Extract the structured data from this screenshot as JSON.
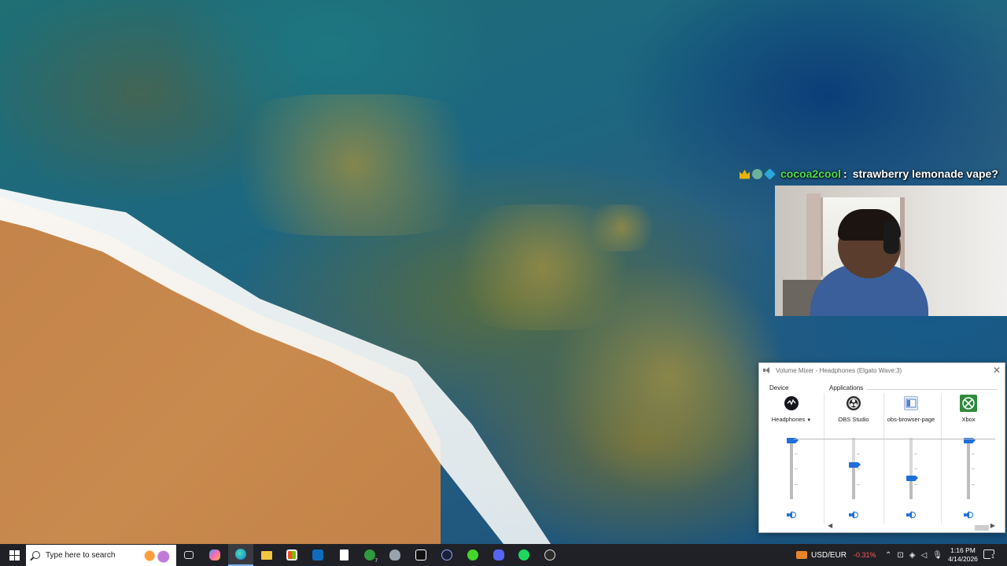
{
  "chat": {
    "username": "cocoa2cool",
    "separator": ":",
    "message": "strawberry lemonade vape?",
    "username_color": "#4ddc4d",
    "badges": [
      "crown-badge",
      "frog-badge",
      "gem-badge"
    ]
  },
  "mixer": {
    "title": "Volume Mixer - Headphones (Elgato Wave:3)",
    "close_label": "✕",
    "device_label": "Device",
    "applications_label": "Applications",
    "channels": [
      {
        "name": "Headphones",
        "icon": "headphones-device-icon",
        "volume": 1.0,
        "has_dropdown": true,
        "dropdown_arrow": "▼"
      },
      {
        "name": "OBS Studio",
        "icon": "obs-studio-icon",
        "volume": 0.56
      },
      {
        "name": "obs-browser-page",
        "icon": "browser-page-icon",
        "volume": 0.32
      },
      {
        "name": "Xbox",
        "icon": "xbox-icon",
        "volume": 1.0
      }
    ],
    "scroll_left": "◀",
    "scroll_right": "▶"
  },
  "taskbar": {
    "search_placeholder": "Type here to search",
    "xbox_badge": "7",
    "pinned_icons": [
      "task-view-icon",
      "copilot-icon",
      "edge-icon",
      "file-explorer-icon",
      "microsoft-store-icon",
      "outlook-icon",
      "notepad-icon",
      "xbox-app-icon",
      "shield-app-icon",
      "epic-games-icon",
      "app-launcher-icon",
      "razer-icon",
      "discord-icon",
      "spotify-icon",
      "obs-icon"
    ],
    "currency_pair": "USD/EUR",
    "currency_change": "-0.31%",
    "time": "1:16 PM",
    "date": "4/14/2026",
    "notification_count": "1",
    "tray_glyphs": [
      "⌃",
      "⊡",
      "◈",
      "◁",
      "🎙"
    ]
  },
  "colors": {
    "accent": "#1e6fd9",
    "taskbar_bg": "#202126",
    "negative": "#ff5a5a"
  }
}
